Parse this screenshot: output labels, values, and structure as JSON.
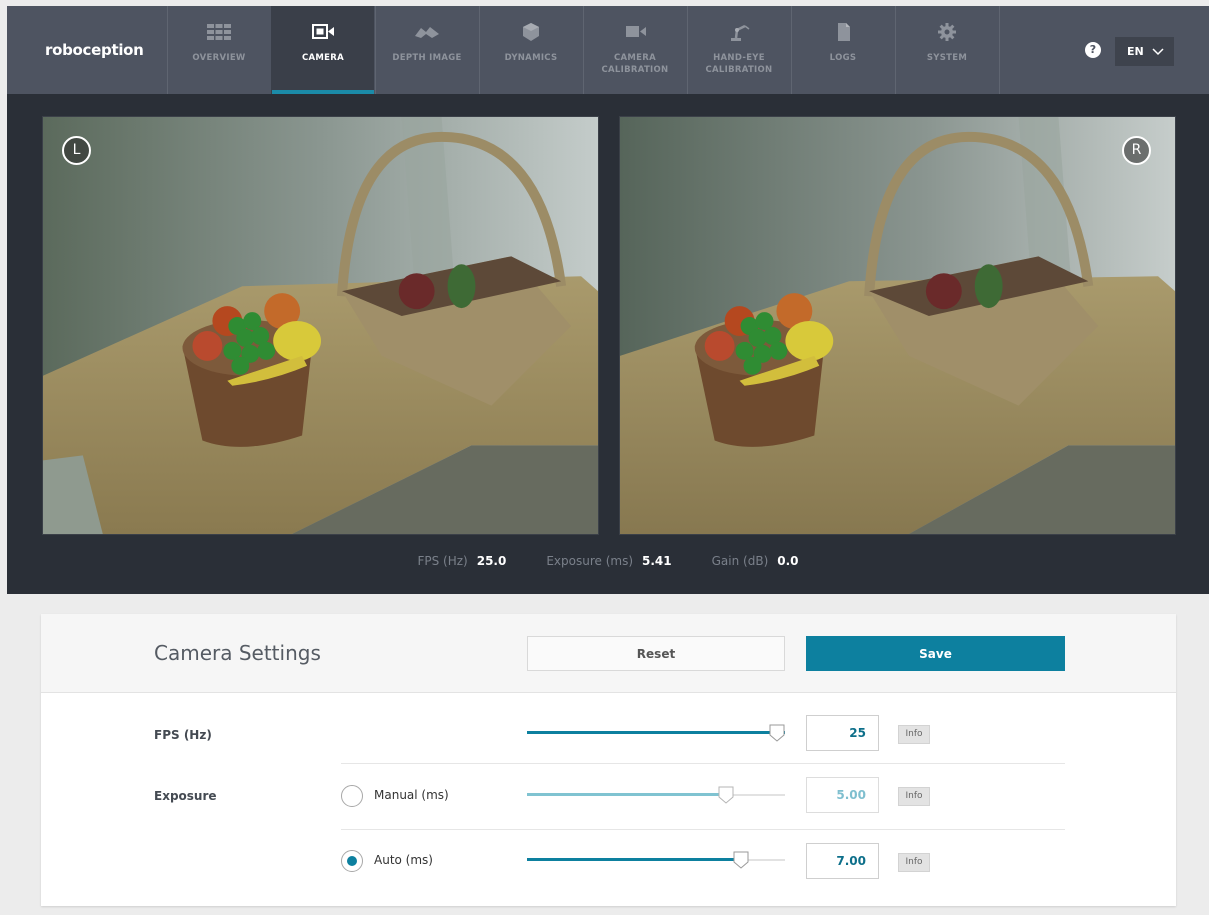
{
  "brand": "roboception",
  "nav": [
    {
      "label": "OVERVIEW",
      "icon": "overview-grid-icon"
    },
    {
      "label": "CAMERA",
      "icon": "camera-icon",
      "active": true
    },
    {
      "label": "DEPTH IMAGE",
      "icon": "depth-image-icon"
    },
    {
      "label": "DYNAMICS",
      "icon": "dynamics-cube-icon"
    },
    {
      "label": "CAMERA CALIBRATION",
      "icon": "camera-calibration-icon"
    },
    {
      "label": "HAND-EYE CALIBRATION",
      "icon": "robot-arm-icon"
    },
    {
      "label": "LOGS",
      "icon": "logs-document-icon"
    },
    {
      "label": "SYSTEM",
      "icon": "system-gear-icon"
    }
  ],
  "help_icon": "?",
  "language": {
    "selected": "EN"
  },
  "images": {
    "left_badge": "L",
    "right_badge": "R"
  },
  "stats": {
    "fps_label": "FPS (Hz)",
    "fps_value": "25.0",
    "exposure_label": "Exposure (ms)",
    "exposure_value": "5.41",
    "gain_label": "Gain (dB)",
    "gain_value": "0.0"
  },
  "settings": {
    "title": "Camera Settings",
    "reset_label": "Reset",
    "save_label": "Save",
    "fps": {
      "label": "FPS (Hz)",
      "value": "25",
      "level": 1.0,
      "info": "Info"
    },
    "exposure": {
      "label": "Exposure",
      "manual": {
        "label": "Manual (ms)",
        "value": "5.00",
        "level": 0.77,
        "selected": false,
        "info": "Info"
      },
      "auto": {
        "label": "Auto (ms)",
        "value": "7.00",
        "level": 0.83,
        "selected": true,
        "info": "Info"
      }
    }
  },
  "colors": {
    "accent": "#0d809f",
    "nav_bg": "#4e5461",
    "stage_bg": "#2a2f37"
  }
}
